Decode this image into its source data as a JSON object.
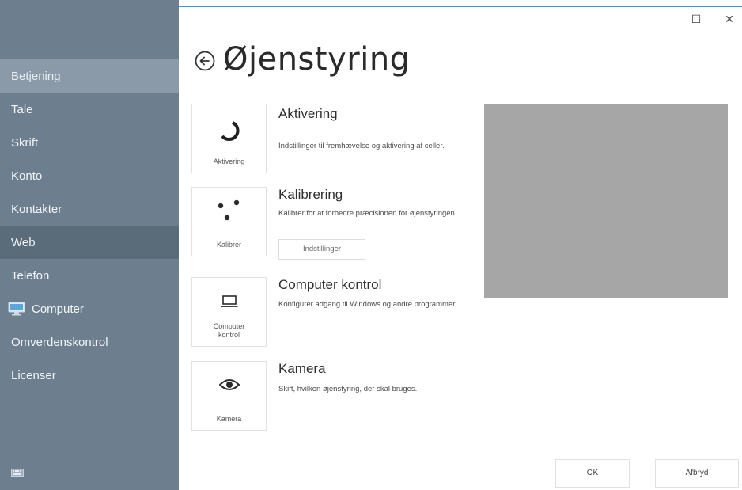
{
  "window": {
    "maximize_glyph": "☐",
    "close_glyph": "✕"
  },
  "sidebar": {
    "items": [
      {
        "label": "Betjening"
      },
      {
        "label": "Tale"
      },
      {
        "label": "Skrift"
      },
      {
        "label": "Konto"
      },
      {
        "label": "Kontakter"
      },
      {
        "label": "Web"
      },
      {
        "label": "Telefon"
      },
      {
        "label": "Computer",
        "icon": "computer-icon"
      },
      {
        "label": "Omverdenskontrol"
      },
      {
        "label": "Licenser"
      }
    ]
  },
  "header": {
    "title": "Øjenstyring",
    "back_icon": "back-arrow-icon"
  },
  "sections": [
    {
      "tile_label": "Aktivering",
      "title": "Aktivering",
      "description": "Indstillinger til fremhævelse og aktivering af celler.",
      "icon": "activation-arc-icon"
    },
    {
      "tile_label": "Kalibrer",
      "title": "Kalibrering",
      "description": "Kalibrer for at forbedre præcisionen for øjenstyringen.",
      "icon": "calibration-dots-icon",
      "button_label": "Indstillinger"
    },
    {
      "tile_label": "Computer kontrol",
      "title": "Computer kontrol",
      "description": "Konfigurer adgang til Windows og andre programmer.",
      "icon": "laptop-icon"
    },
    {
      "tile_label": "Kamera",
      "title": "Kamera",
      "description": "Skift, hvilken øjenstyring, der skal bruges.",
      "icon": "eye-icon"
    }
  ],
  "footer": {
    "ok_label": "OK",
    "cancel_label": "Afbryd"
  },
  "colors": {
    "sidebar_bg": "#6d7f8e",
    "preview_bg": "#a6a6a6",
    "accent_line": "#3a9ad9"
  }
}
